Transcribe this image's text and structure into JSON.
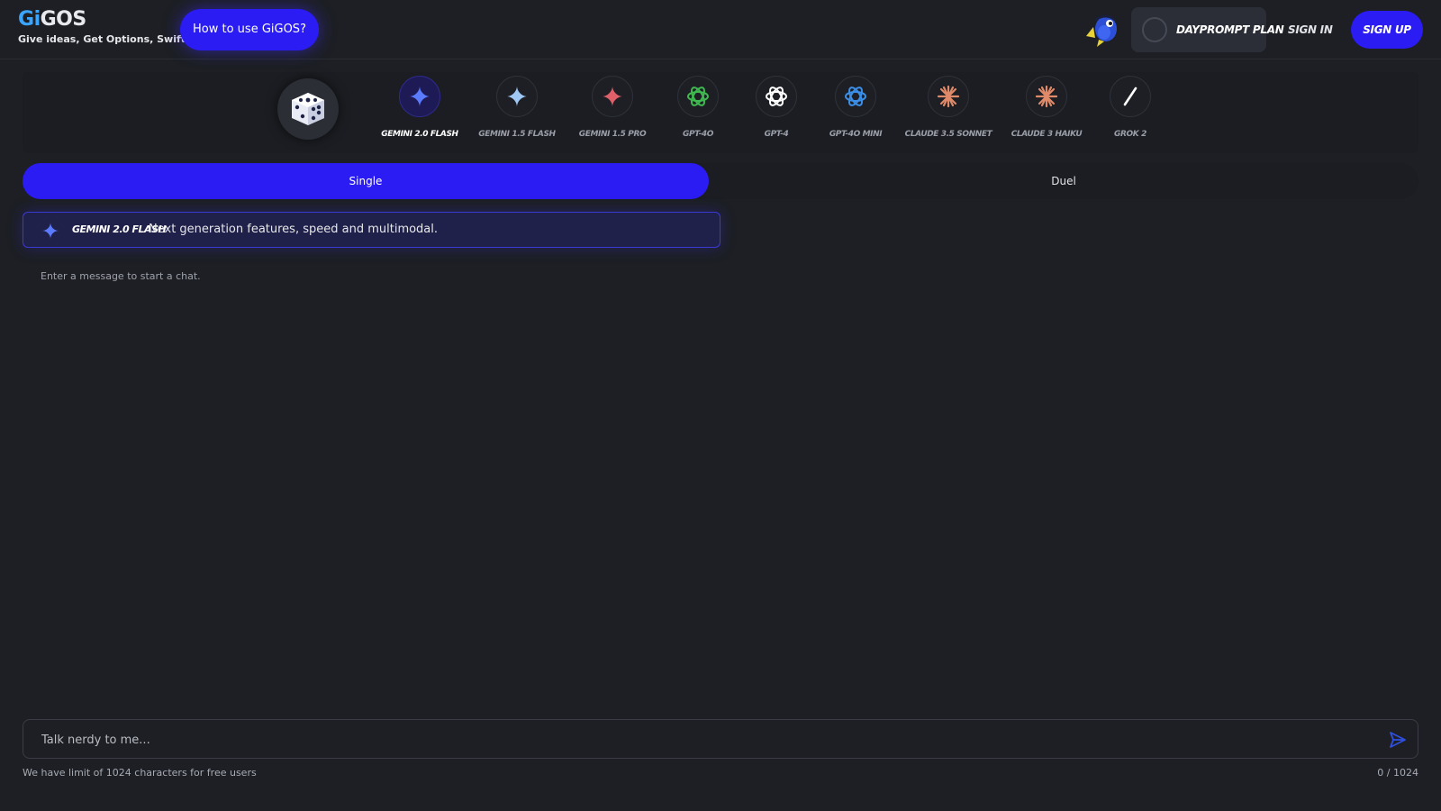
{
  "header": {
    "logo_g": "G",
    "logo_i": "i",
    "logo_rest": "GOS",
    "tagline": "Give ideas, Get Options, Swiftly",
    "how_to_label": "How to use GiGOS?",
    "plan_label": "DayPrompt Plan",
    "sign_in_label": "Sign In",
    "sign_up_label": "Sign Up"
  },
  "models": [
    {
      "name": "Gemini 2.0 Flash",
      "icon": "gemini-icon",
      "color": "#5b7bff",
      "active": true
    },
    {
      "name": "Gemini 1.5 Flash",
      "icon": "gemini-icon",
      "color": "#9fc8f5",
      "active": false
    },
    {
      "name": "Gemini 1.5 Pro",
      "icon": "gemini-icon",
      "color": "#e0606a",
      "active": false
    },
    {
      "name": "GPT-4o",
      "icon": "openai-icon",
      "color": "#3fb950",
      "active": false
    },
    {
      "name": "GPT-4",
      "icon": "openai-icon",
      "color": "#ffffff",
      "active": false
    },
    {
      "name": "GPT-4o mini",
      "icon": "openai-icon",
      "color": "#3b8fe8",
      "active": false
    },
    {
      "name": "Claude 3.5 Sonnet",
      "icon": "claude-icon",
      "color": "#e08a6a",
      "active": false
    },
    {
      "name": "Claude 3 Haiku",
      "icon": "claude-icon",
      "color": "#e08a6a",
      "active": false
    },
    {
      "name": "Grok 2",
      "icon": "grok-icon",
      "color": "#ffffff",
      "active": false
    }
  ],
  "mode": {
    "single_label": "Single",
    "duel_label": "Duel"
  },
  "info": {
    "model_name": "Gemini 2.0 Flash",
    "description": "Next generation features, speed and multimodal."
  },
  "chat": {
    "empty_message": "Enter a message to start a chat."
  },
  "composer": {
    "placeholder": "Talk nerdy to me...",
    "value": "",
    "limit_note": "We have limit of 1024 characters for free users",
    "counter": "0 / 1024"
  },
  "colors": {
    "accent": "#2a1cf2",
    "background": "#1d1f24"
  }
}
